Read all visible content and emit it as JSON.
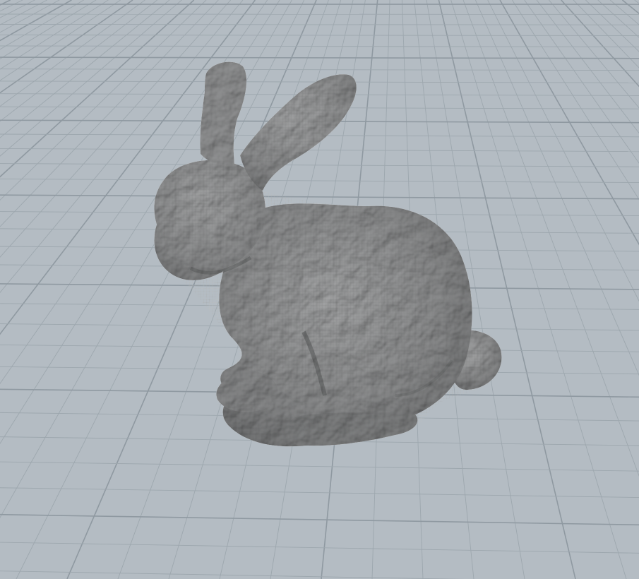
{
  "viewport": {
    "kind": "3d-scene-viewport",
    "background_color": "#b4bcc3",
    "grid_color": "#9da7ae",
    "grid_major_color": "#8f99a1",
    "object": {
      "name": "stanford-bunny",
      "surface_color": "#8d8e8f",
      "shading": "smooth-wireframe-mesh"
    }
  }
}
